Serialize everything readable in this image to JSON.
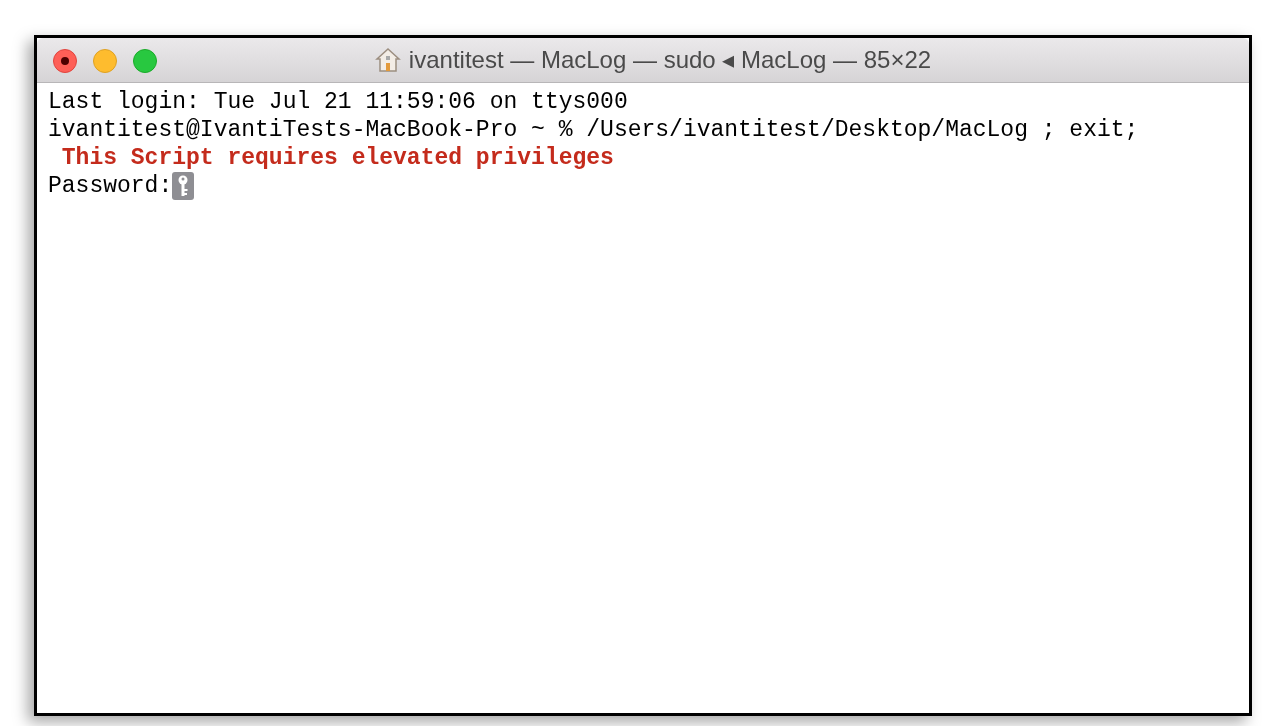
{
  "window": {
    "title": "ivantitest — MacLog — sudo ◂ MacLog — 85×22"
  },
  "terminal": {
    "lines": [
      {
        "kind": "output",
        "text": "Last login: Tue Jul 21 11:59:06 on ttys000"
      },
      {
        "kind": "output",
        "text": "ivantitest@IvantiTests-MacBook-Pro ~ % /Users/ivantitest/Desktop/MacLog ; exit;"
      },
      {
        "kind": "error",
        "text": " This Script requires elevated privileges"
      },
      {
        "kind": "password",
        "text": "Password:"
      }
    ]
  }
}
